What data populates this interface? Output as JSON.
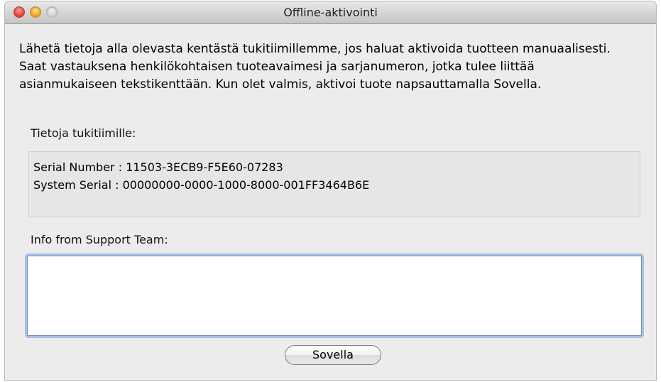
{
  "window": {
    "title": "Offline-aktivointi"
  },
  "content": {
    "description": "Lähetä tietoja alla olevasta kentästä tukitiimillemme, jos haluat aktivoida tuotteen manuaalisesti.  Saat vastauksena henkilökohtaisen tuoteavaimesi ja sarjanumeron, jotka tulee liittää asianmukaiseen tekstikenttään. Kun olet valmis, aktivoi tuote napsauttamalla Sovella.",
    "info_label": "Tietoja tukitiimille:",
    "info_lines": [
      "Serial Number : 11503-3ECB9-F5E60-07283",
      "System Serial : 00000000-0000-1000-8000-001FF3464B6E"
    ],
    "support_label": "Info from Support Team:",
    "support_value": "",
    "apply_button": "Sovella"
  }
}
